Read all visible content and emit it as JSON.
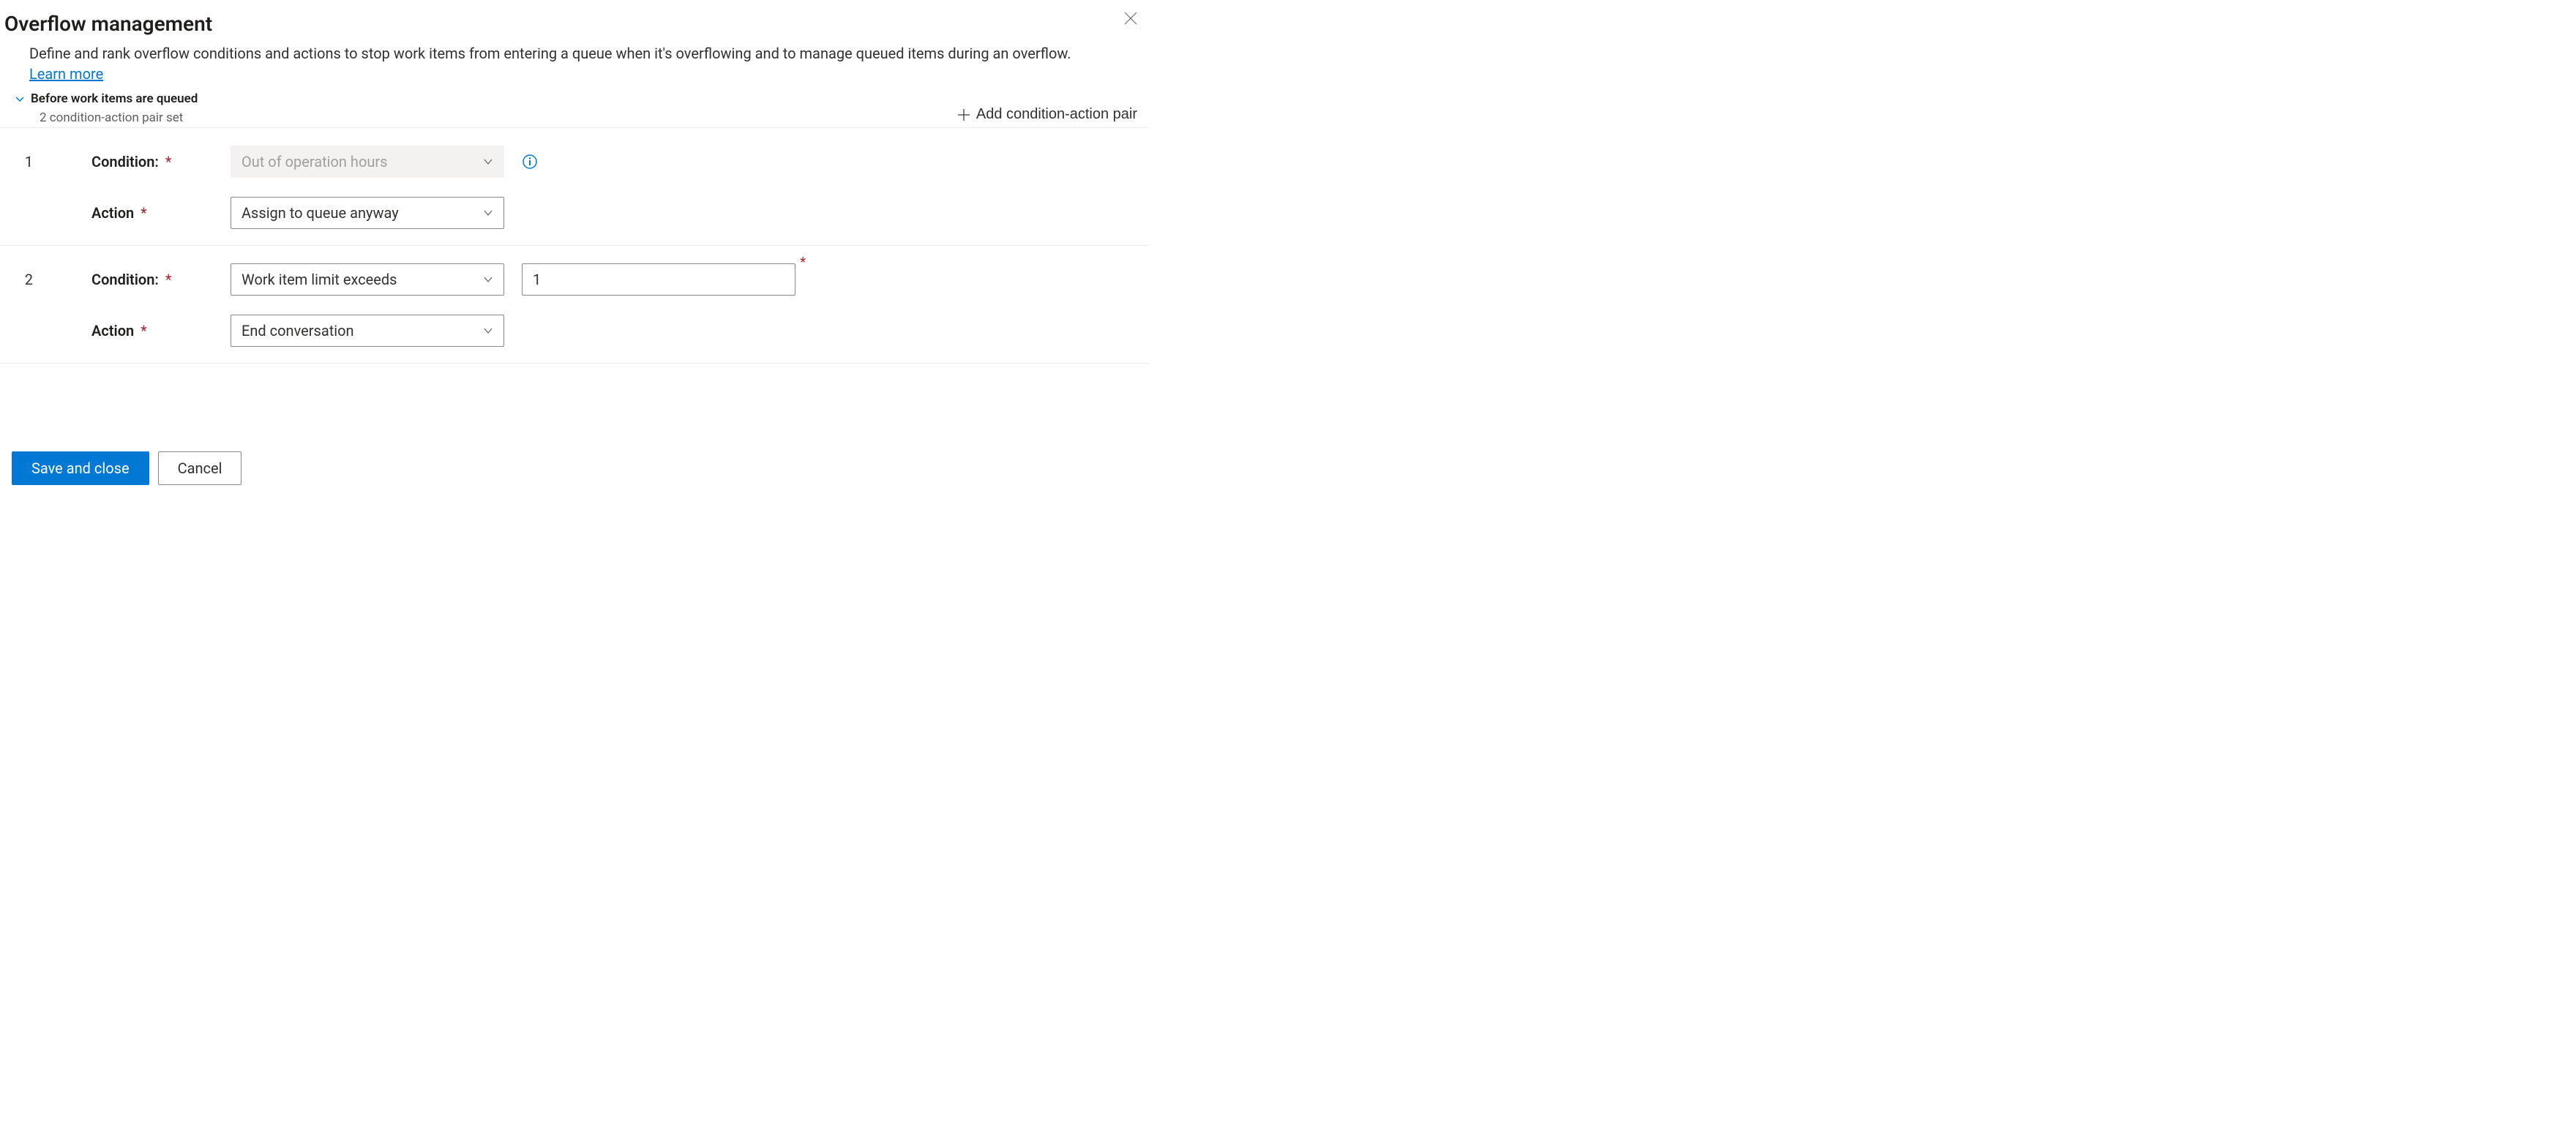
{
  "header": {
    "title": "Overflow management",
    "description_prefix": "Define and rank overflow conditions and actions to stop work items from entering a queue when it's overflowing and to manage queued items during an overflow. ",
    "learn_more_label": "Learn more"
  },
  "section": {
    "title": "Before work items are queued",
    "subtitle": "2 condition-action pair set",
    "add_button_label": "Add condition-action pair"
  },
  "labels": {
    "condition": "Condition:",
    "action": "Action"
  },
  "pairs": [
    {
      "index": "1",
      "condition_value": "Out of operation hours",
      "condition_disabled": true,
      "has_info": true,
      "extra_input": null,
      "action_value": "Assign to queue anyway"
    },
    {
      "index": "2",
      "condition_value": "Work item limit exceeds",
      "condition_disabled": false,
      "has_info": false,
      "extra_input": "1",
      "action_value": "End conversation"
    }
  ],
  "footer": {
    "save_label": "Save and close",
    "cancel_label": "Cancel"
  }
}
